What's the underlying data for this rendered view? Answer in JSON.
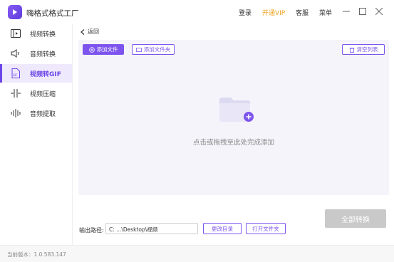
{
  "app": {
    "title": "嗨格式格式工厂"
  },
  "header": {
    "login": "登录",
    "vip": "开通VIP",
    "service": "客服",
    "menu": "菜单"
  },
  "sidebar": {
    "items": [
      {
        "label": "视频转换",
        "icon": "video-convert-icon"
      },
      {
        "label": "音频转换",
        "icon": "audio-convert-icon"
      },
      {
        "label": "视频转GIF",
        "icon": "gif-icon",
        "active": true
      },
      {
        "label": "视频压缩",
        "icon": "compress-icon"
      },
      {
        "label": "音频提取",
        "icon": "audio-extract-icon"
      }
    ]
  },
  "main": {
    "back": "返回",
    "add_file": "添加文件",
    "add_folder": "添加文件夹",
    "clear_list": "清空列表",
    "hint": "点击或拖拽至此处完成添加",
    "convert_all": "全部转换",
    "output_label": "输出路径:",
    "output_path": "C: ...\\Desktop\\视频",
    "change_dir": "更改目录",
    "open_folder": "打开文件夹"
  },
  "footer": {
    "version": "当前版本：1.0.583.147"
  },
  "colors": {
    "accent": "#7d55ee",
    "vip": "#f0a11b",
    "disabled": "#c9c9c9"
  }
}
